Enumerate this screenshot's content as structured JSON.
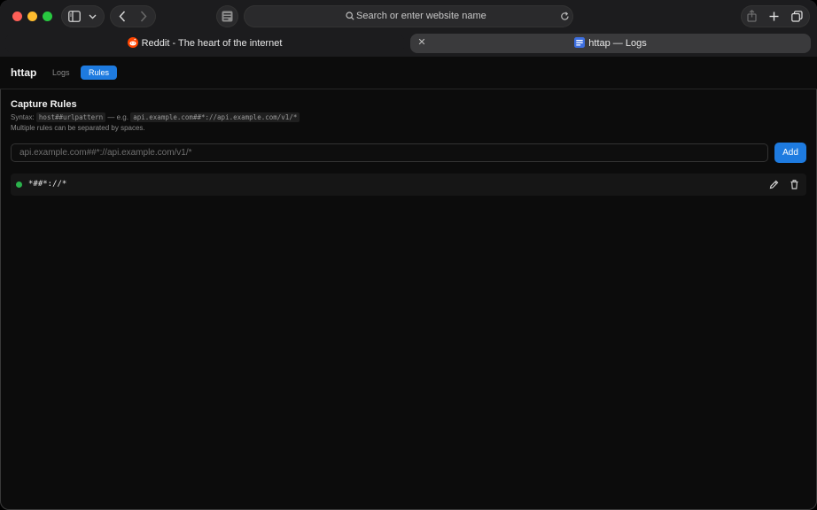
{
  "browser": {
    "address_placeholder": "Search or enter website name",
    "tabs": [
      {
        "title": "Reddit - The heart of the internet",
        "icon": "reddit-icon",
        "active": false
      },
      {
        "title": "httap — Logs",
        "icon": "httap-icon",
        "active": true
      }
    ]
  },
  "app": {
    "title": "httap",
    "tabs": [
      {
        "label": "Logs",
        "active": false
      },
      {
        "label": "Rules",
        "active": true
      }
    ],
    "accent_color": "#1e7be0"
  },
  "capture_rules": {
    "title": "Capture Rules",
    "syntax_label": "Syntax:",
    "syntax_pattern": "host##urlpattern",
    "example_label": "— e.g.",
    "example_pattern": "api.example.com##*://api.example.com/v1/*",
    "hint": "Multiple rules can be separated by spaces.",
    "input_value": "",
    "input_placeholder": "api.example.com##*://api.example.com/v1/*",
    "add_label": "Add",
    "rules": [
      {
        "pattern": "*##*://*",
        "status": "active",
        "status_color": "#2bb24c"
      }
    ]
  }
}
